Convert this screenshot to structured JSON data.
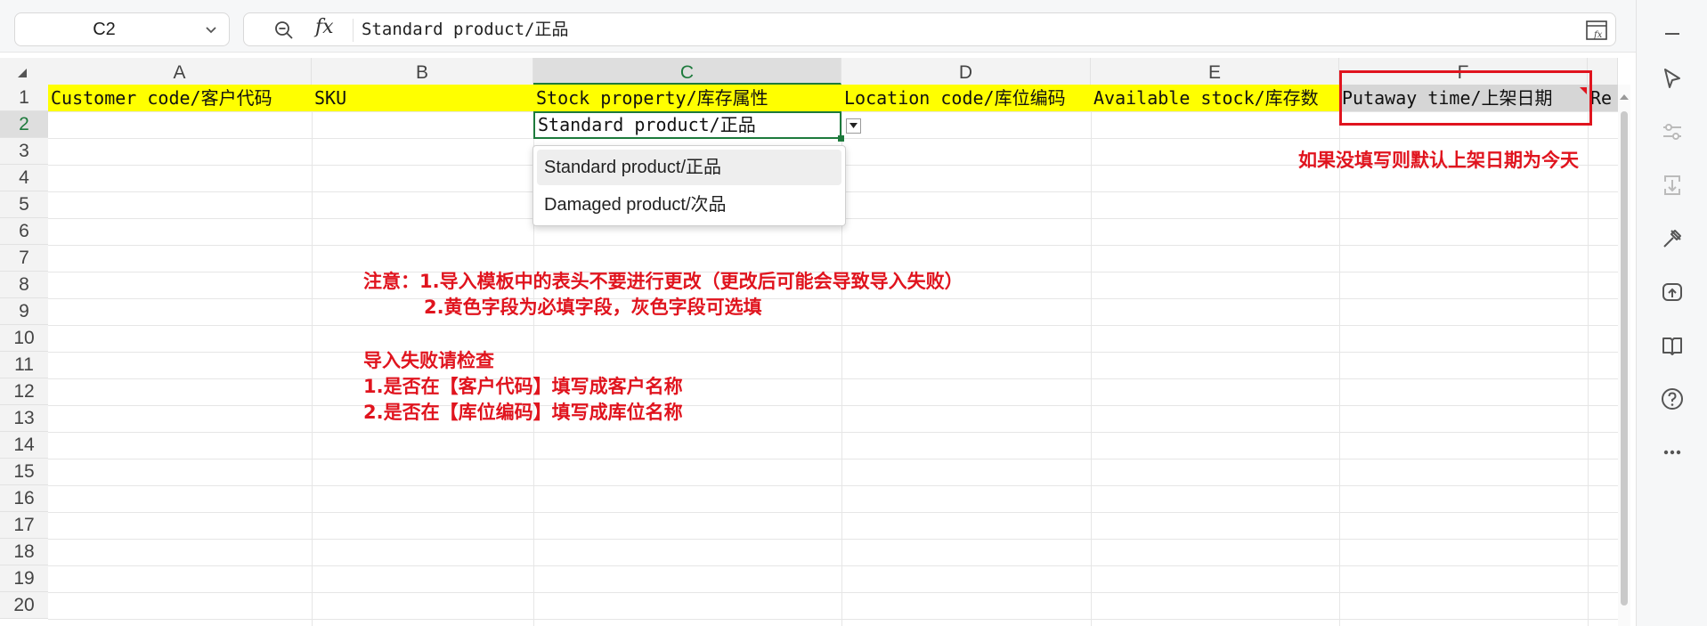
{
  "namebox": {
    "cell_ref": "C2"
  },
  "formula_bar": {
    "fx_label": "fx",
    "content": "Standard product/正品"
  },
  "columns": [
    "A",
    "B",
    "C",
    "D",
    "E",
    "F"
  ],
  "active_column": "C",
  "rows": [
    "1",
    "2",
    "3",
    "4",
    "5",
    "6",
    "7",
    "8",
    "9",
    "10",
    "11",
    "12",
    "13",
    "14",
    "15",
    "16",
    "17",
    "18",
    "19",
    "20"
  ],
  "active_row": "2",
  "header_row": {
    "A": "Customer code/客户代码",
    "B": "SKU",
    "C": "Stock property/库存属性",
    "D": "Location code/库位编码",
    "E": "Available stock/库存数",
    "F": "Putaway time/上架日期",
    "G_partial": "Re"
  },
  "selected_cell_value": "Standard product/正品",
  "dropdown": {
    "options": [
      "Standard product/正品",
      "Damaged product/次品"
    ],
    "highlighted_index": 0
  },
  "annotations": {
    "putaway_note": "如果没填写则默认上架日期为今天",
    "note_line1": "注意：1.导入模板中的表头不要进行更改（更改后可能会导致导入失败）",
    "note_line2": "2.黄色字段为必填字段，灰色字段可选填",
    "check_title": "导入失败请检查",
    "check_line1": "1.是否在【客户代码】填写成客户名称",
    "check_line2": "2.是否在【库位编码】填写成库位名称"
  },
  "colors": {
    "required": "#ffff00",
    "optional": "#d6d6d6",
    "annotation": "#e0141e",
    "selection": "#1d7a3c"
  },
  "toolbar_icons": [
    "minimize-icon",
    "cursor-icon",
    "sliders-icon",
    "transform-icon",
    "tools-icon",
    "ai-assist-icon",
    "book-icon",
    "help-icon",
    "more-icon"
  ]
}
